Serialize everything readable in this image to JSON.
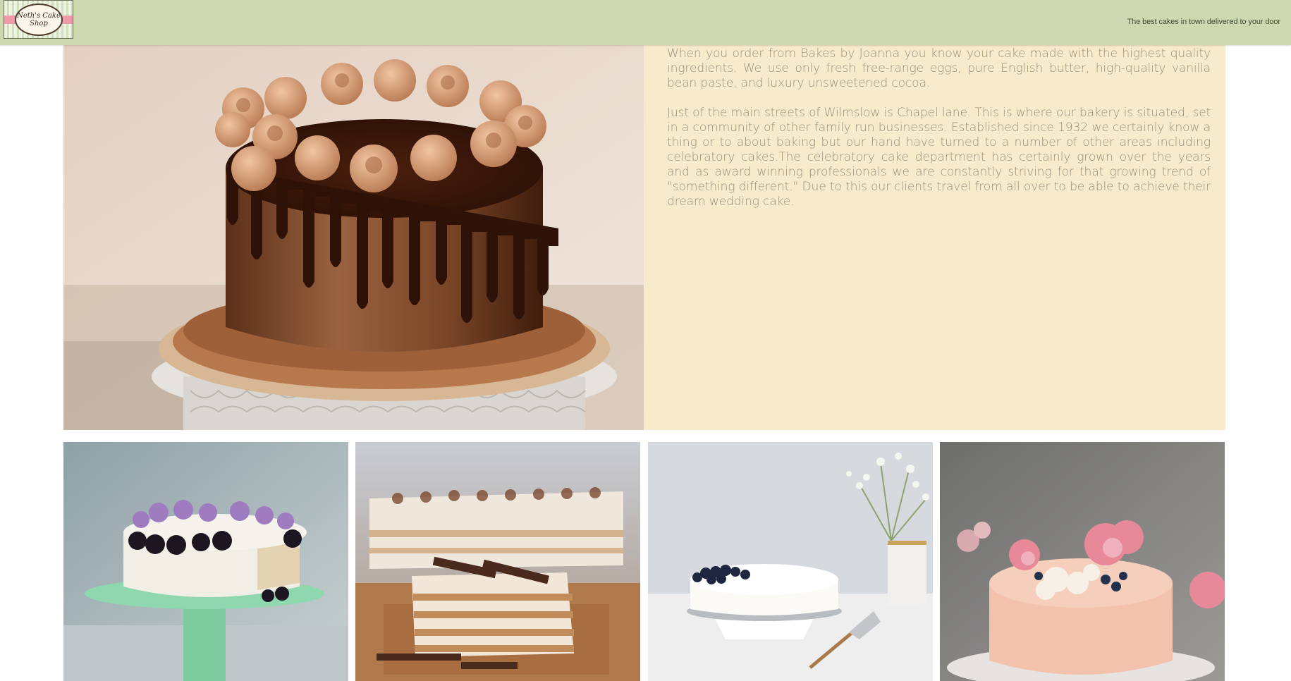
{
  "header": {
    "logo_line1": "Neth's Cake",
    "logo_line2": "Shop",
    "tagline": "The best cakes in town delivered to your door"
  },
  "about": {
    "paragraph1": "When you order from Bakes by Joanna you know your cake made with the highest quality ingredients. We use only fresh free-range eggs, pure English butter, high-quality vanilla bean paste, and luxury unsweetened cocoa.",
    "paragraph2": "Just of the main streets of Wilmslow is Chapel lane. This is where our bakery is situated, set in a community of other family run businesses. Established since 1932 we certainly know a thing or to about baking but our hand have turned to a number of other areas including celebratory cakes.The celebratory cake department has certainly grown over the years and as award winning professionals we are constantly striving for that growing trend of \"something different.\" Due to this our clients travel from all over to be able to achieve their dream wedding cake."
  },
  "colors": {
    "header_bg": "#cdd9b0",
    "text_panel_bg": "#f8ebcc",
    "body_text": "#9a8f7c"
  }
}
